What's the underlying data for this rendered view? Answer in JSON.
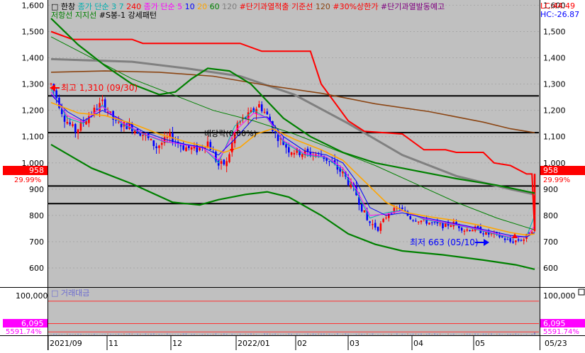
{
  "legend": {
    "row1": [
      {
        "text": "□ 한창",
        "color": "#000000"
      },
      {
        "text": "종가 단순 3",
        "color": "#00b0b0"
      },
      {
        "text": "7",
        "color": "#00b0b0"
      },
      {
        "text": "240",
        "color": "#ff0000"
      },
      {
        "text": "종가 단순 5",
        "color": "#ff00ff"
      },
      {
        "text": "10",
        "color": "#0000ff"
      },
      {
        "text": "20",
        "color": "#ffa500"
      },
      {
        "text": "60",
        "color": "#008000"
      },
      {
        "text": "120",
        "color": "#808080"
      },
      {
        "text": "#단기과열적출",
        "color": "#ff0000"
      },
      {
        "text": "기준선",
        "color": "#ff0000"
      },
      {
        "text": "120",
        "color": "#8b4513"
      },
      {
        "text": "#30%상한가",
        "color": "#ff0000"
      },
      {
        "text": "#단기과열발동예고",
        "color": "#800080"
      }
    ],
    "row2": [
      {
        "text": "저항선",
        "color": "#008000"
      },
      {
        "text": "지지선",
        "color": "#008000"
      },
      {
        "text": "#S봉-1 강세패턴",
        "color": "#000000"
      }
    ]
  },
  "top_right": {
    "lc": "LC:44.49",
    "hc": "HC:-26.87"
  },
  "price_axis": {
    "ticks": [
      600,
      700,
      800,
      900,
      1000,
      1100,
      1200,
      1300,
      1400,
      1500,
      1600
    ]
  },
  "current_price": {
    "value": 958,
    "label": "958",
    "pct": "29.99%",
    "pct_left": "29.99%",
    "color": "#ff0000"
  },
  "annotations": {
    "high": "최고 1,310 (09/30)",
    "low": "최저 663 (05/10)",
    "event": "배당락(0.00%)"
  },
  "horizontal_levels": [
    1255,
    1115,
    912,
    845
  ],
  "volume_panel": {
    "title": "□ 거래대금",
    "axis_label": "100,000",
    "current_label": "6,095",
    "pct_label": "5591.74%",
    "pct_label_left": "5591.74%",
    "gridlines": [
      100000,
      33000,
      8000
    ],
    "ymax": 140000
  },
  "x_axis": {
    "labels": [
      "2021/09",
      "11",
      "12",
      "2022/01",
      "02",
      "03",
      "04",
      "05",
      "05/23"
    ]
  },
  "chart_data": {
    "type": "candlestick",
    "x_range": [
      "2021-09-01",
      "2022-05-23"
    ],
    "y_range": [
      530,
      1620
    ],
    "n_bars": 180,
    "ohlc_keypoints": [
      [
        0,
        1300
      ],
      [
        5,
        1170
      ],
      [
        9,
        1120
      ],
      [
        14,
        1180
      ],
      [
        19,
        1230
      ],
      [
        24,
        1150
      ],
      [
        29,
        1140
      ],
      [
        34,
        1110
      ],
      [
        39,
        1060
      ],
      [
        44,
        1100
      ],
      [
        49,
        1060
      ],
      [
        54,
        1050
      ],
      [
        58,
        1080
      ],
      [
        62,
        990
      ],
      [
        65,
        1000
      ],
      [
        69,
        1150
      ],
      [
        73,
        1180
      ],
      [
        77,
        1220
      ],
      [
        80,
        1180
      ],
      [
        83,
        1110
      ],
      [
        88,
        1050
      ],
      [
        92,
        1040
      ],
      [
        96,
        1035
      ],
      [
        100,
        1030
      ],
      [
        103,
        1005
      ],
      [
        108,
        960
      ],
      [
        113,
        880
      ],
      [
        117,
        780
      ],
      [
        121,
        750
      ],
      [
        125,
        810
      ],
      [
        129,
        830
      ],
      [
        133,
        790
      ],
      [
        137,
        780
      ],
      [
        141,
        770
      ],
      [
        145,
        760
      ],
      [
        149,
        770
      ],
      [
        153,
        745
      ],
      [
        157,
        750
      ],
      [
        161,
        730
      ],
      [
        165,
        725
      ],
      [
        170,
        700
      ],
      [
        175,
        710
      ],
      [
        178,
        745
      ],
      [
        179,
        958
      ]
    ],
    "series": [
      {
        "name": "3",
        "color": "#00b0b0",
        "values": [
          [
            0,
            1280
          ],
          [
            6,
            1170
          ],
          [
            12,
            1150
          ],
          [
            19,
            1220
          ],
          [
            26,
            1150
          ],
          [
            34,
            1110
          ],
          [
            42,
            1080
          ],
          [
            50,
            1070
          ],
          [
            56,
            1060
          ],
          [
            62,
            1000
          ],
          [
            68,
            1140
          ],
          [
            75,
            1200
          ],
          [
            80,
            1170
          ],
          [
            86,
            1080
          ],
          [
            94,
            1030
          ],
          [
            102,
            1020
          ],
          [
            108,
            970
          ],
          [
            113,
            890
          ],
          [
            118,
            790
          ],
          [
            124,
            810
          ],
          [
            130,
            820
          ],
          [
            138,
            785
          ],
          [
            146,
            770
          ],
          [
            154,
            755
          ],
          [
            162,
            735
          ],
          [
            170,
            715
          ],
          [
            176,
            720
          ],
          [
            179,
            800
          ]
        ]
      },
      {
        "name": "5",
        "color": "#ff00ff",
        "values": [
          [
            0,
            1270
          ],
          [
            6,
            1180
          ],
          [
            12,
            1155
          ],
          [
            19,
            1215
          ],
          [
            26,
            1155
          ],
          [
            34,
            1112
          ],
          [
            42,
            1082
          ],
          [
            50,
            1068
          ],
          [
            56,
            1058
          ],
          [
            62,
            1010
          ],
          [
            68,
            1120
          ],
          [
            75,
            1190
          ],
          [
            80,
            1172
          ],
          [
            86,
            1085
          ],
          [
            94,
            1035
          ],
          [
            102,
            1022
          ],
          [
            108,
            980
          ],
          [
            113,
            900
          ],
          [
            118,
            800
          ],
          [
            124,
            805
          ],
          [
            130,
            818
          ],
          [
            138,
            788
          ],
          [
            146,
            772
          ],
          [
            154,
            757
          ],
          [
            162,
            738
          ],
          [
            170,
            718
          ],
          [
            176,
            718
          ],
          [
            179,
            760
          ]
        ]
      },
      {
        "name": "10",
        "color": "#0000ff",
        "values": [
          [
            0,
            1260
          ],
          [
            6,
            1195
          ],
          [
            12,
            1160
          ],
          [
            19,
            1200
          ],
          [
            26,
            1165
          ],
          [
            34,
            1120
          ],
          [
            42,
            1090
          ],
          [
            50,
            1070
          ],
          [
            56,
            1060
          ],
          [
            62,
            1030
          ],
          [
            68,
            1090
          ],
          [
            75,
            1170
          ],
          [
            80,
            1175
          ],
          [
            86,
            1100
          ],
          [
            94,
            1045
          ],
          [
            102,
            1030
          ],
          [
            108,
            1000
          ],
          [
            113,
            930
          ],
          [
            118,
            830
          ],
          [
            124,
            800
          ],
          [
            130,
            810
          ],
          [
            138,
            792
          ],
          [
            146,
            776
          ],
          [
            154,
            760
          ],
          [
            162,
            742
          ],
          [
            170,
            724
          ],
          [
            176,
            718
          ],
          [
            179,
            735
          ]
        ]
      },
      {
        "name": "20",
        "color": "#ffa500",
        "values": [
          [
            0,
            1230
          ],
          [
            10,
            1190
          ],
          [
            20,
            1180
          ],
          [
            30,
            1150
          ],
          [
            40,
            1110
          ],
          [
            50,
            1080
          ],
          [
            58,
            1060
          ],
          [
            64,
            1040
          ],
          [
            70,
            1060
          ],
          [
            76,
            1110
          ],
          [
            82,
            1130
          ],
          [
            90,
            1090
          ],
          [
            100,
            1050
          ],
          [
            108,
            1010
          ],
          [
            116,
            930
          ],
          [
            124,
            850
          ],
          [
            132,
            810
          ],
          [
            140,
            795
          ],
          [
            150,
            780
          ],
          [
            160,
            760
          ],
          [
            170,
            735
          ],
          [
            176,
            725
          ],
          [
            179,
            730
          ]
        ]
      },
      {
        "name": "60",
        "color": "#008000",
        "values": [
          [
            0,
            1480
          ],
          [
            15,
            1400
          ],
          [
            30,
            1320
          ],
          [
            45,
            1260
          ],
          [
            60,
            1200
          ],
          [
            75,
            1160
          ],
          [
            90,
            1110
          ],
          [
            105,
            1050
          ],
          [
            120,
            990
          ],
          [
            135,
            920
          ],
          [
            150,
            850
          ],
          [
            165,
            790
          ],
          [
            179,
            745
          ]
        ]
      },
      {
        "name": "120",
        "color": "#808080",
        "values": [
          [
            0,
            1395
          ],
          [
            30,
            1385
          ],
          [
            50,
            1360
          ],
          [
            70,
            1330
          ],
          [
            90,
            1260
          ],
          [
            110,
            1150
          ],
          [
            130,
            1030
          ],
          [
            150,
            950
          ],
          [
            170,
            900
          ],
          [
            179,
            880
          ]
        ]
      },
      {
        "name": "기준선",
        "color": "#ff0000",
        "values": [
          [
            0,
            1500
          ],
          [
            8,
            1470
          ],
          [
            30,
            1470
          ],
          [
            34,
            1455
          ],
          [
            70,
            1455
          ],
          [
            78,
            1425
          ],
          [
            96,
            1425
          ],
          [
            100,
            1300
          ],
          [
            110,
            1160
          ],
          [
            116,
            1120
          ],
          [
            130,
            1110
          ],
          [
            138,
            1050
          ],
          [
            146,
            1050
          ],
          [
            150,
            1040
          ],
          [
            160,
            1040
          ],
          [
            164,
            1000
          ],
          [
            170,
            990
          ],
          [
            176,
            958
          ],
          [
            178,
            958
          ],
          [
            179,
            740
          ]
        ]
      },
      {
        "name": "240",
        "color": "#8b4513",
        "values": [
          [
            0,
            1345
          ],
          [
            20,
            1350
          ],
          [
            40,
            1345
          ],
          [
            60,
            1330
          ],
          [
            80,
            1295
          ],
          [
            100,
            1265
          ],
          [
            120,
            1225
          ],
          [
            140,
            1195
          ],
          [
            160,
            1155
          ],
          [
            170,
            1130
          ],
          [
            179,
            1115
          ]
        ]
      },
      {
        "name": "저항선",
        "color": "#008000",
        "values": [
          [
            0,
            1550
          ],
          [
            10,
            1450
          ],
          [
            20,
            1370
          ],
          [
            30,
            1300
          ],
          [
            40,
            1260
          ],
          [
            46,
            1270
          ],
          [
            52,
            1320
          ],
          [
            58,
            1360
          ],
          [
            66,
            1350
          ],
          [
            74,
            1300
          ],
          [
            86,
            1170
          ],
          [
            96,
            1100
          ],
          [
            108,
            1040
          ],
          [
            120,
            1000
          ],
          [
            135,
            970
          ],
          [
            150,
            940
          ],
          [
            165,
            915
          ],
          [
            179,
            885
          ]
        ]
      },
      {
        "name": "지지선",
        "color": "#008000",
        "values": [
          [
            0,
            1070
          ],
          [
            15,
            980
          ],
          [
            30,
            920
          ],
          [
            45,
            850
          ],
          [
            55,
            840
          ],
          [
            62,
            860
          ],
          [
            72,
            880
          ],
          [
            80,
            890
          ],
          [
            88,
            870
          ],
          [
            100,
            800
          ],
          [
            110,
            730
          ],
          [
            120,
            690
          ],
          [
            130,
            665
          ],
          [
            145,
            650
          ],
          [
            160,
            630
          ],
          [
            172,
            612
          ],
          [
            179,
            595
          ]
        ]
      }
    ]
  }
}
